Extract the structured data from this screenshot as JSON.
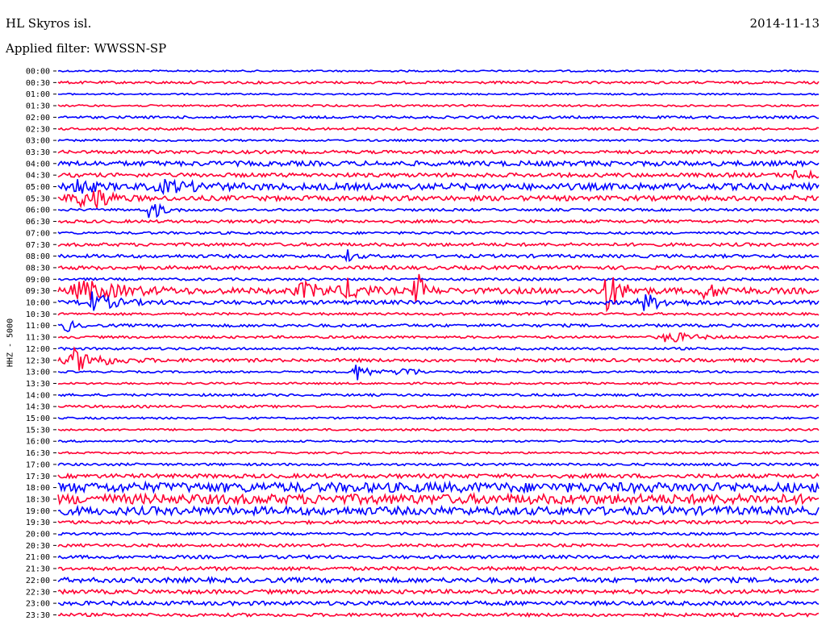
{
  "header": {
    "station": "HL Skyros isl.",
    "date": "2014-11-13",
    "filter": "Applied filter: WWSSN-SP"
  },
  "chart_data": {
    "type": "line",
    "title": "HL Skyros isl.",
    "ylabel": "HHZ - 5000",
    "colors": {
      "even": "#0000ff",
      "odd": "#ff0033"
    },
    "tick_labels": [
      "00:00",
      "00:30",
      "01:00",
      "01:30",
      "02:00",
      "02:30",
      "03:00",
      "03:30",
      "04:00",
      "04:30",
      "05:00",
      "05:30",
      "06:00",
      "06:30",
      "07:00",
      "07:30",
      "08:00",
      "08:30",
      "09:00",
      "09:30",
      "10:00",
      "10:30",
      "11:00",
      "11:30",
      "12:00",
      "12:30",
      "13:00",
      "13:30",
      "14:00",
      "14:30",
      "15:00",
      "15:30",
      "16:00",
      "16:30",
      "17:00",
      "17:30",
      "18:00",
      "18:30",
      "19:00",
      "19:30",
      "20:00",
      "20:30",
      "21:00",
      "21:30",
      "22:00",
      "22:30",
      "23:00",
      "23:30"
    ],
    "noise": [
      1,
      1.5,
      1,
      1.2,
      1.5,
      1.5,
      1.2,
      2,
      3,
      2.5,
      4,
      3,
      1.5,
      1.8,
      1.5,
      2,
      2,
      2.2,
      1.5,
      3.5,
      2.5,
      1.5,
      1.8,
      1.5,
      1.5,
      2,
      1.2,
      1.2,
      1.5,
      1.5,
      1.2,
      1.2,
      1.2,
      1.2,
      1.5,
      2.5,
      6,
      6,
      5,
      2,
      1.5,
      1.8,
      2,
      2.2,
      3,
      2.5,
      2.5,
      2
    ],
    "events": [
      {
        "trace": 9,
        "t": 0.97,
        "amp": 5,
        "w": 0.03
      },
      {
        "trace": 10,
        "t": 0.02,
        "amp": 12,
        "w": 0.02
      },
      {
        "trace": 10,
        "t": 0.14,
        "amp": 6,
        "w": 0.05
      },
      {
        "trace": 11,
        "t": 0.02,
        "amp": 16,
        "w": 0.02
      },
      {
        "trace": 11,
        "t": 0.05,
        "amp": 12,
        "w": 0.02
      },
      {
        "trace": 12,
        "t": 0.12,
        "amp": 16,
        "w": 0.015
      },
      {
        "trace": 16,
        "t": 0.38,
        "amp": 8,
        "w": 0.01
      },
      {
        "trace": 19,
        "t": 0.03,
        "amp": 12,
        "w": 0.06
      },
      {
        "trace": 19,
        "t": 0.32,
        "amp": 9,
        "w": 0.04
      },
      {
        "trace": 19,
        "t": 0.38,
        "amp": 12,
        "w": 0.02
      },
      {
        "trace": 19,
        "t": 0.47,
        "amp": 30,
        "w": 0.01
      },
      {
        "trace": 19,
        "t": 0.72,
        "amp": 28,
        "w": 0.02
      },
      {
        "trace": 19,
        "t": 0.85,
        "amp": 8,
        "w": 0.03
      },
      {
        "trace": 20,
        "t": 0.04,
        "amp": 14,
        "w": 0.03
      },
      {
        "trace": 20,
        "t": 0.77,
        "amp": 10,
        "w": 0.03
      },
      {
        "trace": 22,
        "t": 0.01,
        "amp": 10,
        "w": 0.01
      },
      {
        "trace": 23,
        "t": 0.8,
        "amp": 8,
        "w": 0.03
      },
      {
        "trace": 25,
        "t": 0.02,
        "amp": 14,
        "w": 0.04
      },
      {
        "trace": 26,
        "t": 0.39,
        "amp": 12,
        "w": 0.02
      },
      {
        "trace": 26,
        "t": 0.45,
        "amp": 8,
        "w": 0.02
      }
    ]
  }
}
